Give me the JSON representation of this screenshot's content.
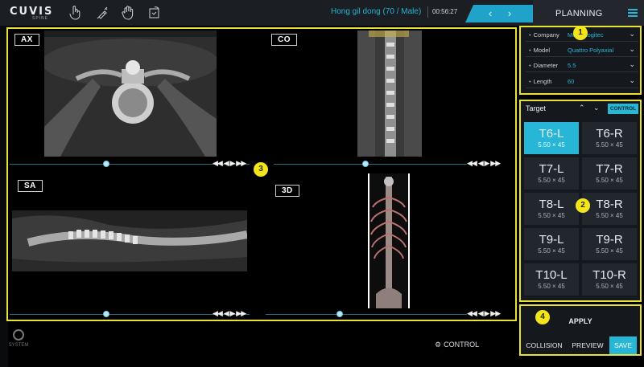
{
  "app": {
    "logo": "CUVIS",
    "logo_sub": "SPINE",
    "patient": "Hong gil dong (70 / Male)",
    "elapsed": "00:56:27",
    "mode": "PLANNING",
    "nav_prev": "‹",
    "nav_next": "›",
    "tools": [
      "hand-touch-icon",
      "syringe-icon",
      "palm-icon",
      "rotate-icon"
    ]
  },
  "viewer": {
    "views": [
      "AX",
      "CO",
      "SA",
      "3D"
    ],
    "play_controls": "◀◀ ◀ ▶ ▶▶"
  },
  "implant": {
    "fields": [
      {
        "label": "Company",
        "value": "Medit Logitec"
      },
      {
        "label": "Model",
        "value": "Quattro Polyaxial"
      },
      {
        "label": "Diameter",
        "value": "5.5"
      },
      {
        "label": "Length",
        "value": "60"
      }
    ]
  },
  "target": {
    "label": "Target",
    "control": "CONTROL",
    "items": [
      {
        "name": "T6-L",
        "size": "5.50 × 45",
        "active": true
      },
      {
        "name": "T6-R",
        "size": "5.50 × 45",
        "active": false
      },
      {
        "name": "T7-L",
        "size": "5.50 × 45",
        "active": false
      },
      {
        "name": "T7-R",
        "size": "5.50 × 45",
        "active": false
      },
      {
        "name": "T8-L",
        "size": "5.50 × 45",
        "active": false
      },
      {
        "name": "T8-R",
        "size": "5.50 × 45",
        "active": false
      },
      {
        "name": "T9-L",
        "size": "5.50 × 45",
        "active": false
      },
      {
        "name": "T9-R",
        "size": "5.50 × 45",
        "active": false
      },
      {
        "name": "T10-L",
        "size": "5.50 × 45",
        "active": false
      },
      {
        "name": "T10-R",
        "size": "5.50 × 45",
        "active": false
      }
    ]
  },
  "actions": {
    "apply": "APPLY",
    "collision": "COLLISION",
    "preview": "PREVIEW",
    "save": "SAVE"
  },
  "footer": {
    "system": "SYSTEM",
    "control": "CONTROL"
  },
  "callouts": [
    "1",
    "2",
    "3",
    "4"
  ],
  "colors": {
    "accent": "#27b6d6",
    "highlight": "#e9e236",
    "badge": "#f3e51c"
  }
}
